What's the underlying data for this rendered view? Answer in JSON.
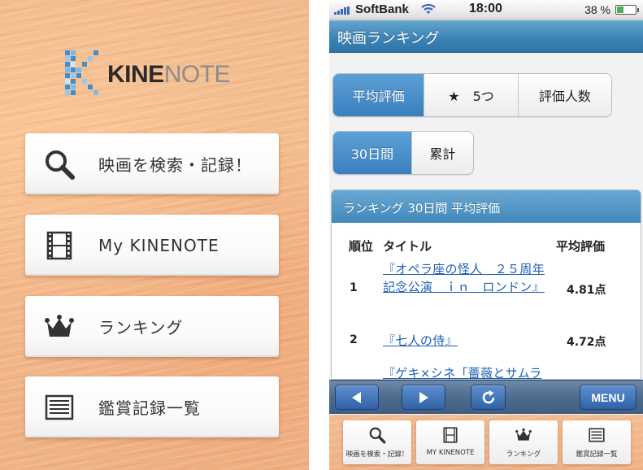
{
  "left_app": {
    "logo": {
      "text_bold": "KINE",
      "text_light": "NOTE"
    },
    "menu": [
      {
        "icon": "search-icon",
        "label": "映画を検索・記録！"
      },
      {
        "icon": "film-icon",
        "label": "My KINENOTE"
      },
      {
        "icon": "crown-icon",
        "label": "ランキング"
      },
      {
        "icon": "list-icon",
        "label": "鑑賞記録一覧"
      }
    ]
  },
  "status_bar": {
    "carrier": "SoftBank",
    "time": "18:00",
    "battery_percent_label": "38 %",
    "battery_level": 0.38
  },
  "navbar": {
    "title": "映画ランキング"
  },
  "sort_segment": {
    "items": [
      "平均評価",
      "★　5つ",
      "評価人数"
    ],
    "selected": 0
  },
  "period_segment": {
    "items": [
      "30日間",
      "累計"
    ],
    "selected": 0
  },
  "ranking": {
    "header": "ランキング 30日間 平均評価",
    "columns": {
      "rank": "順位",
      "title": "タイトル",
      "score": "平均評価"
    },
    "rows": [
      {
        "rank": "1",
        "title": "『オペラ座の怪人　２５周年記念公演　ｉｎ　ロンドン』",
        "score": "4.81点"
      },
      {
        "rank": "2",
        "title": "『七人の侍』",
        "score": "4.72点"
      },
      {
        "rank": "",
        "title": "『ゲキ×シネ「薔薇とサムライ」』",
        "score": ""
      }
    ]
  },
  "toolbar": {
    "back": "back-arrow-icon",
    "forward": "forward-arrow-icon",
    "reload": "reload-icon",
    "menu_label": "MENU"
  },
  "tabbar": [
    {
      "icon": "search-icon",
      "label": "映画を検索・記録！"
    },
    {
      "icon": "film-icon",
      "label": "MY KINENOTE"
    },
    {
      "icon": "crown-icon",
      "label": "ランキング"
    },
    {
      "icon": "list-icon",
      "label": "鑑賞記録一覧"
    }
  ],
  "colors": {
    "accent_blue": "#3d84b6",
    "link_blue": "#1d5fb3",
    "background_orange": "#f1b98c"
  }
}
